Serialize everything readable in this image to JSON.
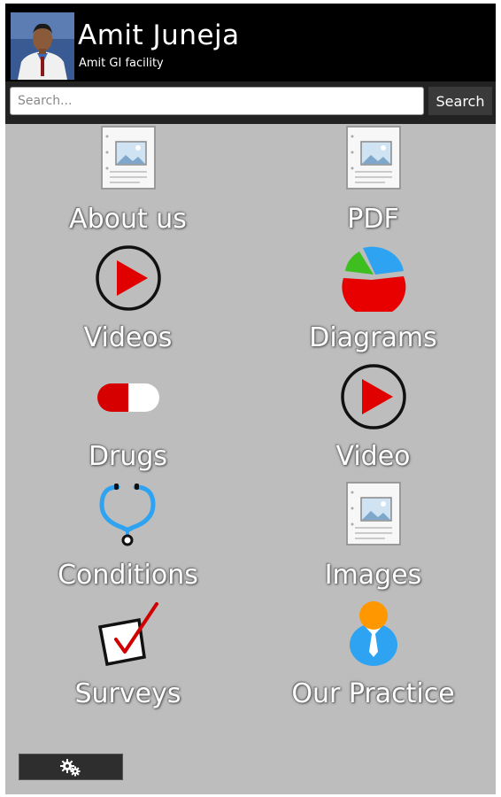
{
  "header": {
    "title": "Amit Juneja",
    "subtitle": "Amit GI facility"
  },
  "search": {
    "placeholder": "Search...",
    "button_label": "Search"
  },
  "grid": {
    "items": [
      {
        "label": "About us",
        "icon": "document-image-icon"
      },
      {
        "label": "PDF",
        "icon": "document-image-icon"
      },
      {
        "label": "Videos",
        "icon": "play-circle-icon"
      },
      {
        "label": "Diagrams",
        "icon": "pie-chart-icon"
      },
      {
        "label": "Drugs",
        "icon": "pill-capsule-icon"
      },
      {
        "label": "Video",
        "icon": "play-circle-icon"
      },
      {
        "label": "Conditions",
        "icon": "stethoscope-icon"
      },
      {
        "label": "Images",
        "icon": "document-image-icon"
      },
      {
        "label": "Surveys",
        "icon": "checkbox-checked-icon"
      },
      {
        "label": "Our Practice",
        "icon": "person-tie-icon"
      }
    ]
  },
  "footer": {
    "settings_icon": "gears-icon"
  },
  "colors": {
    "background": "#bdbdbd",
    "header": "#000000",
    "accent_red": "#e00000",
    "accent_blue": "#2ea3f2",
    "accent_orange": "#ff9800"
  }
}
